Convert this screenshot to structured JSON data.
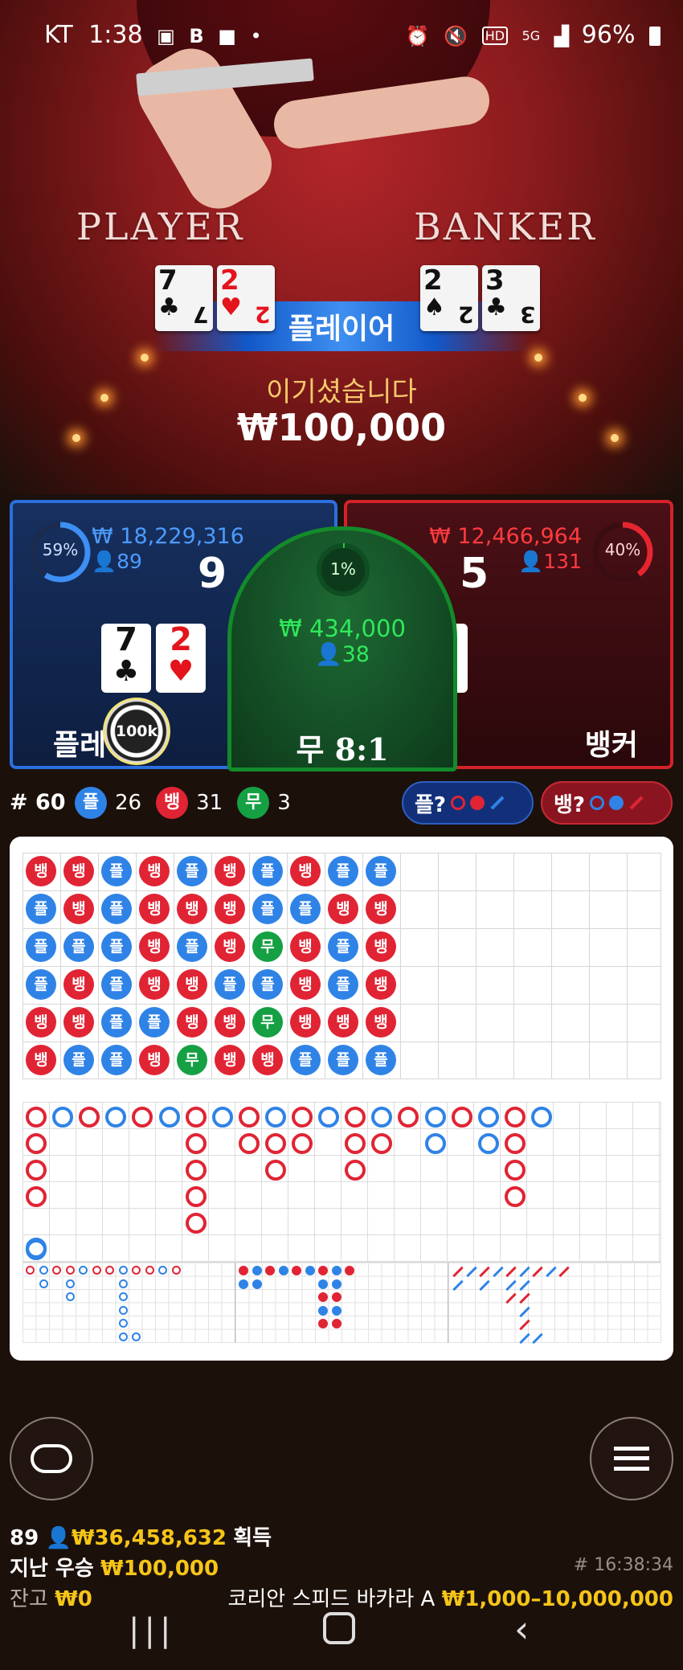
{
  "status_bar": {
    "carrier": "KT",
    "time": "1:38",
    "battery": "96%",
    "icons_left": [
      "image-icon",
      "b-icon",
      "chat-icon",
      "dot-icon"
    ],
    "icons_right": [
      "alarm-icon",
      "mute-icon",
      "hd-icon",
      "5g-icon",
      "signal-icon",
      "battery-icon"
    ]
  },
  "table": {
    "player_label": "PLAYER",
    "banker_label": "BANKER",
    "player_cards": [
      {
        "rank": "7",
        "suit": "♣"
      },
      {
        "rank": "2",
        "suit": "♥"
      }
    ],
    "banker_cards": [
      {
        "rank": "2",
        "suit": "♠"
      },
      {
        "rank": "3",
        "suit": "♣"
      }
    ],
    "winner_banner": "플레이어",
    "win_message": "이기셨습니다",
    "win_amount": "₩100,000"
  },
  "bets": {
    "player": {
      "percent": "59%",
      "percent_value": 59,
      "total": "₩ 18,229,316",
      "players": "89",
      "score": "9",
      "label": "플레이어",
      "chip": "100k",
      "cards": [
        {
          "rank": "7",
          "suit": "♣"
        },
        {
          "rank": "2",
          "suit": "♥"
        }
      ]
    },
    "tie": {
      "percent": "1%",
      "percent_value": 1,
      "total": "₩ 434,000",
      "players": "38",
      "label": "무 8:1"
    },
    "banker": {
      "percent": "40%",
      "percent_value": 40,
      "total": "₩ 12,466,964",
      "players": "131",
      "score": "5",
      "label": "뱅커",
      "cards": [
        {
          "rank": "2",
          "suit": "♠"
        },
        {
          "rank": "3",
          "suit": "♣"
        }
      ]
    }
  },
  "stats": {
    "round_label": "# 60",
    "player_badge": "플",
    "player_count": "26",
    "banker_badge": "뱅",
    "banker_count": "31",
    "tie_badge": "무",
    "tie_count": "3",
    "ask_player": "플?",
    "ask_banker": "뱅?"
  },
  "bead_road": [
    [
      "뱅",
      "플",
      "플",
      "플",
      "뱅",
      "뱅"
    ],
    [
      "뱅",
      "뱅",
      "플",
      "뱅",
      "뱅",
      "플"
    ],
    [
      "플",
      "플",
      "플",
      "플",
      "플",
      "플"
    ],
    [
      "뱅",
      "뱅",
      "뱅",
      "뱅",
      "플",
      "뱅"
    ],
    [
      "플",
      "뱅",
      "플",
      "뱅",
      "뱅",
      "무"
    ],
    [
      "뱅",
      "뱅",
      "뱅",
      "플",
      "뱅",
      "뱅"
    ],
    [
      "플",
      "플",
      "무",
      "플",
      "무",
      "뱅"
    ],
    [
      "뱅",
      "플",
      "뱅",
      "뱅",
      "뱅",
      "플"
    ],
    [
      "플",
      "뱅",
      "플",
      "플",
      "뱅",
      "플"
    ],
    [
      "플",
      "뱅",
      "뱅",
      "뱅",
      "뱅",
      "플"
    ]
  ],
  "controls": {
    "chat_icon": "chat-bubble-icon",
    "menu_icon": "hamburger-menu-icon"
  },
  "footer": {
    "online_count": "89",
    "total_won": "₩36,458,632",
    "won_suffix": "획득",
    "last_win_label": "지난 우승",
    "last_win_amount": "₩100,000",
    "round_id": "# 16:38:34",
    "balance_label": "잔고",
    "balance": "₩0",
    "table_name": "코리안 스피드 바카라 A",
    "limits": "₩1,000–10,000,000"
  }
}
